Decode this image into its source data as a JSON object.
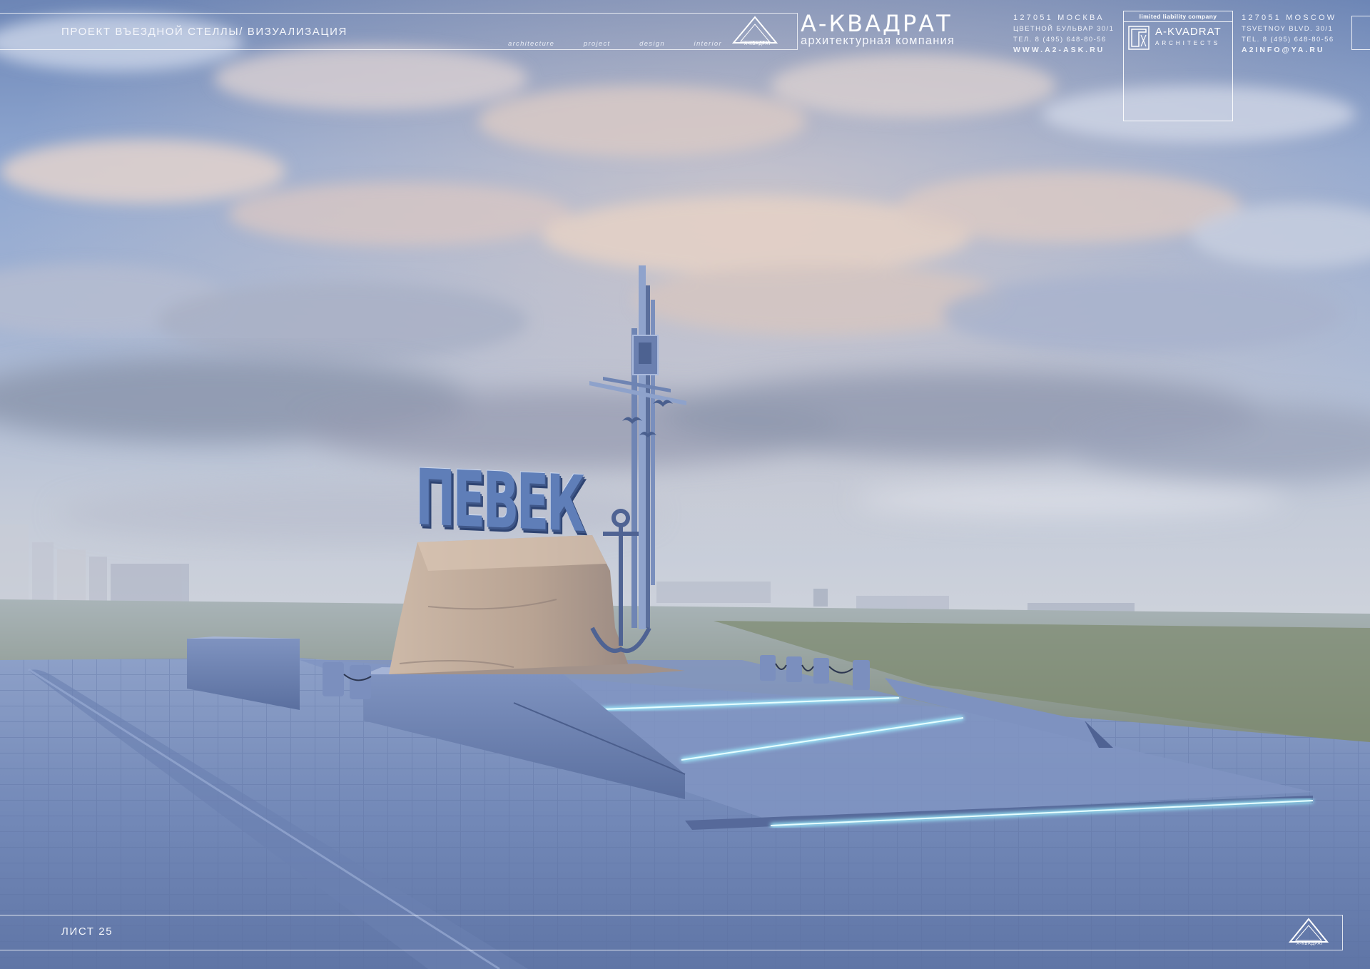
{
  "header": {
    "project_title": "ПРОЕКТ ВЪЕЗДНОЙ СТЕЛЛЫ/ ВИЗУАЛИЗАЦИЯ",
    "tagline": [
      "architecture",
      "project",
      "design",
      "interior"
    ],
    "logo_caption": "А-КВАДРАТ",
    "brand_name": "А-КВАДРАТ",
    "brand_subtitle": "архитектурная компания",
    "address_ru": {
      "postcode_city": "127051 МОСКВА",
      "street": "ЦВЕТНОЙ БУЛЬВАР 30/1",
      "phone": "ТЕЛ. 8 (495) 648-80-56",
      "website": "WWW.A2-ASK.RU"
    },
    "company_box": {
      "heading": "limited liability company",
      "name": "A-KVADRAT",
      "subtitle": "ARCHITECTS"
    },
    "address_en": {
      "postcode_city": "127051 MOSCOW",
      "street": "TSVETNOY BLVD. 30/1",
      "phone": "TEL. 8 (495) 648-80-56",
      "email": "A2INFO@YA.RU"
    }
  },
  "stele": {
    "lettering": "ПЕВЕК"
  },
  "footer": {
    "sheet_label": "ЛИСТ 25",
    "logo_caption": "А-КВАДРАТ"
  },
  "colors": {
    "sky_top": "#6d86b6",
    "sky_mid": "#9fb4d8",
    "horizon_haze": "#c7cfdc",
    "pavement": "#7187b6",
    "stone": "#b9a79a",
    "led_glow": "#9ff0ff",
    "lettering": "#5f7eb8",
    "overlay_text": "#ffffff"
  },
  "icons": [
    "a-kvadrat-triangle-logo-icon",
    "a-kvadrat-architects-logo-icon",
    "anchor-icon",
    "seagull-icon"
  ]
}
